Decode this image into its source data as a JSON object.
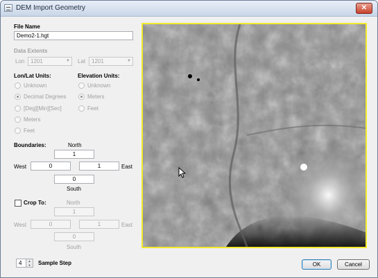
{
  "window": {
    "title": "DEM Import Geometry",
    "close_label": "✕"
  },
  "file": {
    "heading": "File Name",
    "value": "Demo2-1.hgt"
  },
  "extents": {
    "heading": "Data Extents",
    "lon_label": "Lon",
    "lon_value": "1201",
    "lat_label": "Lat",
    "lat_value": "1201"
  },
  "lonlat_units": {
    "heading": "Lon/Lat Units:",
    "options": [
      "Unknown",
      "Decimal Degrees",
      "[Deg][Min][Sec]",
      "Meters",
      "Feet"
    ],
    "selected": "Decimal Degrees"
  },
  "elevation_units": {
    "heading": "Elevation Units:",
    "options": [
      "Unknown",
      "Meters",
      "Feet"
    ],
    "selected": "Meters"
  },
  "boundaries": {
    "heading": "Boundaries:",
    "north_label": "North",
    "north_value": "1",
    "west_label": "West",
    "west_value": "0",
    "east_label": "East",
    "east_value": "1",
    "south_label": "South",
    "south_value": "0"
  },
  "crop": {
    "label": "Crop To:",
    "checked": false,
    "north_label": "North",
    "north_value": "1",
    "west_label": "West",
    "west_value": "0",
    "east_label": "East",
    "east_value": "1",
    "south_label": "South",
    "south_value": "0"
  },
  "sample_step": {
    "label": "Sample Step",
    "value": "4"
  },
  "buttons": {
    "ok": "OK",
    "cancel": "Cancel"
  },
  "colors": {
    "preview_border": "#f2ea2c",
    "close_button": "#c8412b"
  }
}
